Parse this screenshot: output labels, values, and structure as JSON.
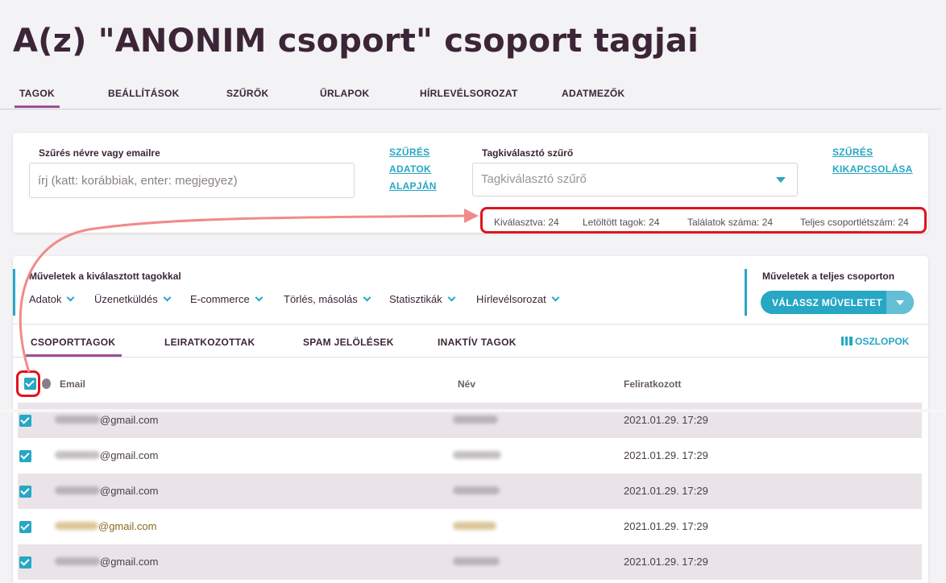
{
  "page": {
    "title": "A(z) \"ANONIM csoport\" csoport tagjai"
  },
  "main_tabs": [
    {
      "label": "TAGOK"
    },
    {
      "label": "BEÁLLÍTÁSOK"
    },
    {
      "label": "SZŰRŐK"
    },
    {
      "label": "ŰRLAPOK"
    },
    {
      "label": "HÍRLEVÉLSOROZAT"
    },
    {
      "label": "ADATMEZŐK"
    }
  ],
  "filter": {
    "name_label": "Szűrés névre vagy emailre",
    "name_placeholder": "írj (katt: korábbiak, enter: megjegyez)",
    "filter_by_data": [
      "SZŰRÉS",
      "ADATOK",
      "ALAPJÁN"
    ],
    "selector_label": "Tagkiválasztó szűrő",
    "selector_placeholder": "Tagkiválasztó szűrő",
    "disable_filter": [
      "SZŰRÉS",
      "KIKAPCSOLÁSA"
    ]
  },
  "stats": {
    "selected": "Kiválasztva: 24",
    "downloaded": "Letöltött tagok: 24",
    "results": "Találatok száma: 24",
    "total": "Teljes csoportlétszám: 24"
  },
  "operations": {
    "selected_title": "Műveletek a kiválasztott tagokkal",
    "items": [
      "Adatok",
      "Üzenetküldés",
      "E-commerce",
      "Törlés, másolás",
      "Statisztikák",
      "Hírlevélsorozat"
    ],
    "group_title": "Műveletek a teljes csoporton",
    "group_button": "VÁLASSZ MŰVELETET"
  },
  "sub_tabs": [
    {
      "label": "CSOPORTTAGOK"
    },
    {
      "label": "LEIRATKOZOTTAK"
    },
    {
      "label": "SPAM JELÖLÉSEK"
    },
    {
      "label": "INAKTÍV TAGOK"
    }
  ],
  "columns_button": "OSZLOPOK",
  "table": {
    "headers": [
      "Email",
      "Név",
      "Feliratkozott"
    ],
    "rows": [
      {
        "email": "@gmail.com",
        "date": "2021.01.29. 17:29"
      },
      {
        "email": "@gmail.com",
        "date": "2021.01.29. 17:29"
      },
      {
        "email": "@gmail.com",
        "date": "2021.01.29. 17:29"
      },
      {
        "email": "@gmail.com",
        "date": "2021.01.29. 17:29"
      },
      {
        "email": "@gmail.com",
        "date": "2021.01.29. 17:29"
      }
    ]
  },
  "colors": {
    "accent": "#27a7c4",
    "tab_underline": "#9b4f9b",
    "highlight": "#e0141f",
    "arrow": "#f28a8a",
    "row_alt": "#eae4e9"
  }
}
